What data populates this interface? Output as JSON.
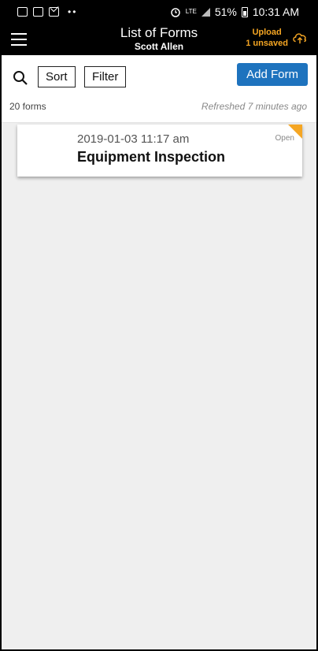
{
  "status_bar": {
    "network": "LTE",
    "battery": "51%",
    "time": "10:31 AM",
    "dots": "••"
  },
  "header": {
    "title": "List of Forms",
    "subtitle": "Scott Allen",
    "upload_label": "Upload",
    "unsaved_label": "1 unsaved",
    "accent_color": "#f5a623"
  },
  "toolbar": {
    "sort_label": "Sort",
    "filter_label": "Filter",
    "add_label": "Add Form",
    "count_label": "20 forms",
    "refreshed_label": "Refreshed 7 minutes ago",
    "primary_color": "#1e73be"
  },
  "forms": [
    {
      "date": "2019-01-03 11:17 am",
      "title": "Equipment Inspection",
      "status": "Open"
    }
  ]
}
